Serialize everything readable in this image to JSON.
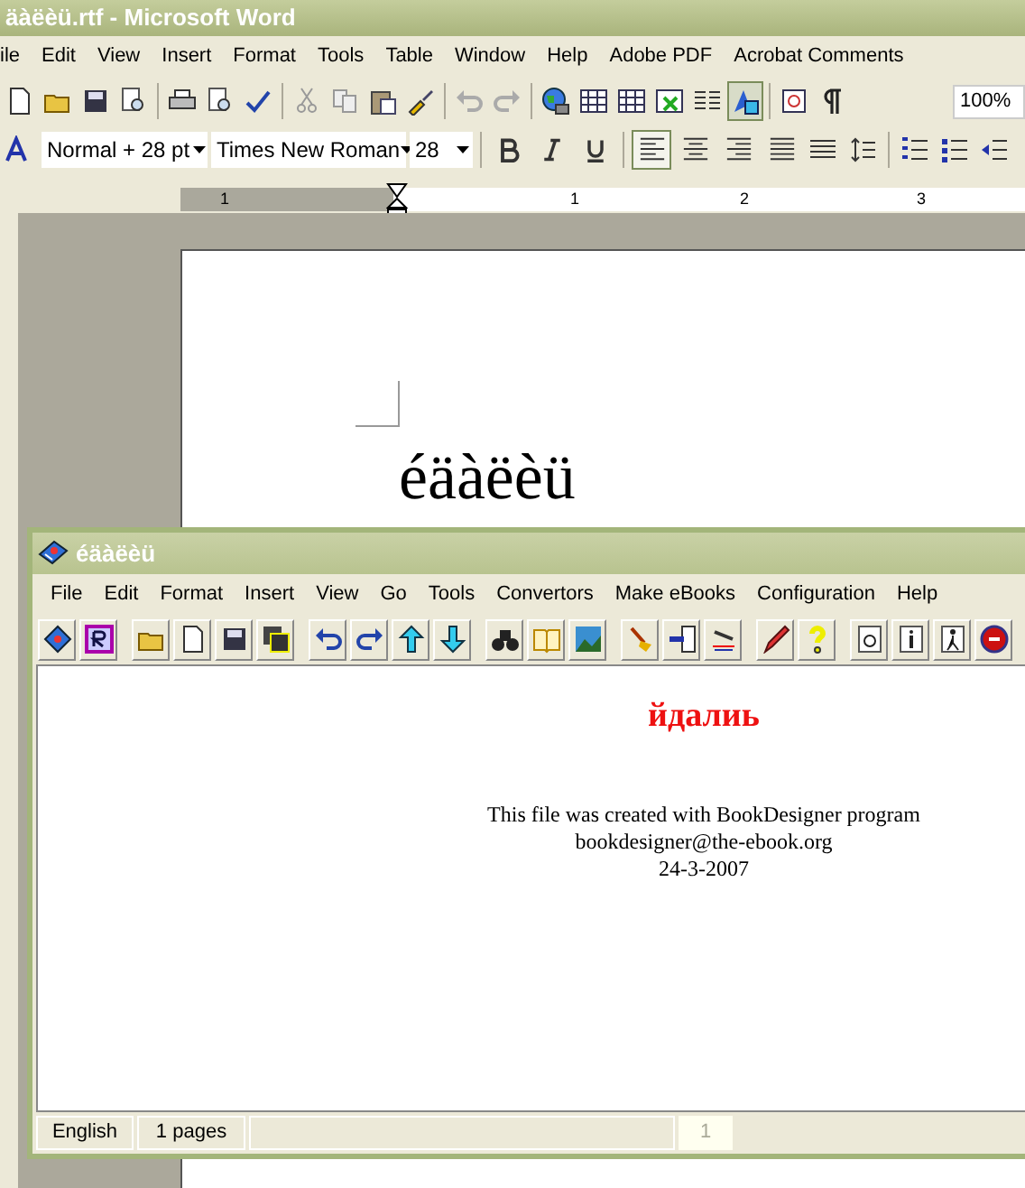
{
  "word": {
    "title": "äàëèü.rtf - Microsoft Word",
    "menu": [
      "ile",
      "Edit",
      "View",
      "Insert",
      "Format",
      "Tools",
      "Table",
      "Window",
      "Help",
      "Adobe PDF",
      "Acrobat Comments"
    ],
    "drawing_pressed": true,
    "zoom": "100%",
    "style": "Normal + 28 pt",
    "font": "Times New Roman",
    "size": "28",
    "alignment": [
      {
        "pressed": true
      },
      {
        "pressed": false
      },
      {
        "pressed": false
      },
      {
        "pressed": false
      }
    ],
    "ruler": [
      "1",
      "1",
      "2",
      "3"
    ],
    "document_text": "éäàëèü"
  },
  "bookdesigner": {
    "title": "éäàëèü",
    "menu": [
      "File",
      "Edit",
      "Format",
      "Insert",
      "View",
      "Go",
      "Tools",
      "Convertors",
      "Make eBooks",
      "Configuration",
      "Help"
    ],
    "heading": "йдалиь",
    "lines": [
      "This file was created with BookDesigner program",
      "bookdesigner@the-ebook.org",
      "24-3-2007"
    ],
    "status": [
      "English",
      "1 pages"
    ],
    "page": "1"
  }
}
